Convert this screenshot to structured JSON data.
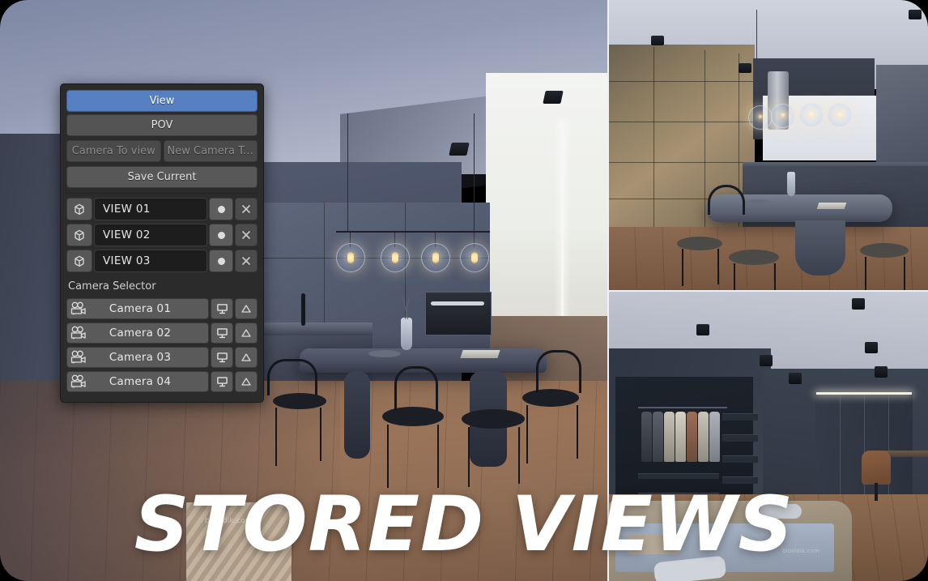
{
  "overlay": {
    "title": "STORED VIEWS",
    "watermark_main": "blosidik.com",
    "watermark_bottom_right": "blosidik.com"
  },
  "panel": {
    "tabs": [
      {
        "label": "View",
        "active": true
      },
      {
        "label": "POV",
        "active": false
      }
    ],
    "actions": [
      {
        "label": "Camera To view",
        "enabled": false
      },
      {
        "label": "New Camera To...",
        "enabled": false
      }
    ],
    "save_current_label": "Save Current",
    "stored_views": [
      {
        "name": "VIEW 01",
        "cube_icon": "cube-icon",
        "dot_icon": "record-dot-icon",
        "delete_icon": "close-x-icon"
      },
      {
        "name": "VIEW 02",
        "cube_icon": "cube-icon",
        "dot_icon": "record-dot-icon",
        "delete_icon": "close-x-icon"
      },
      {
        "name": "VIEW 03",
        "cube_icon": "cube-icon",
        "dot_icon": "record-dot-icon",
        "delete_icon": "close-x-icon"
      }
    ],
    "camera_selector": {
      "label": "Camera Selector",
      "cameras": [
        {
          "name": "Camera 01",
          "camera_icon": "movie-camera-icon",
          "view_icon": "monitor-icon",
          "lock_icon": "triangle-icon"
        },
        {
          "name": "Camera 02",
          "camera_icon": "movie-camera-icon",
          "view_icon": "monitor-icon",
          "lock_icon": "triangle-icon"
        },
        {
          "name": "Camera 03",
          "camera_icon": "movie-camera-icon",
          "view_icon": "monitor-icon",
          "lock_icon": "triangle-icon"
        },
        {
          "name": "Camera 04",
          "camera_icon": "movie-camera-icon",
          "view_icon": "monitor-icon",
          "lock_icon": "triangle-icon"
        }
      ]
    }
  },
  "colors": {
    "accent_blue": "#5680c2",
    "panel_bg": "#2b2b2b",
    "button_gray": "#585858",
    "field_dark": "#1d1d1d",
    "text": "#d8d8d8",
    "title_white": "#ffffff"
  },
  "viewports": [
    {
      "name": "main-viewport",
      "description": "Kitchen and dining room render, wide angle"
    },
    {
      "name": "top-right-viewport",
      "description": "Kitchen island render"
    },
    {
      "name": "bottom-right-viewport",
      "description": "Bedroom with walk-in closet render"
    }
  ]
}
